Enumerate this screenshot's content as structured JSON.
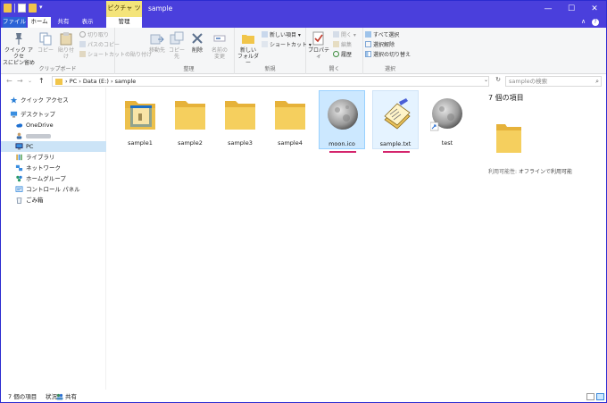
{
  "window": {
    "title": "sample",
    "context_tab": "ピクチャ ツール",
    "qat_dropdown": "▾",
    "controls": {
      "minimize": "—",
      "maximize": "☐",
      "close": "✕"
    }
  },
  "tabs": {
    "file": "ファイル",
    "home": "ホーム",
    "share": "共有",
    "view": "表示",
    "manage": "管理",
    "help": "?",
    "collapse": "∧"
  },
  "ribbon": {
    "clipboard": {
      "label": "クリップボード",
      "pin_line1": "クイック アクセ",
      "pin_line2": "スにピン留め",
      "copy": "コピー",
      "paste": "貼り付け",
      "cut": "切り取り",
      "copy_path": "パスのコピー",
      "paste_shortcut": "ショートカットの貼り付け"
    },
    "organize": {
      "label": "整理",
      "move_to": "移動先",
      "copy_to": "コピー先",
      "delete": "削除",
      "rename_line1": "名前の",
      "rename_line2": "変更"
    },
    "new": {
      "label": "新規",
      "new_folder_line1": "新しい",
      "new_folder_line2": "フォルダー",
      "new_item": "新しい項目 ▾",
      "shortcut": "ショートカット ▾"
    },
    "open": {
      "label": "開く",
      "properties": "プロパティ",
      "open": "開く ▾",
      "edit": "編集",
      "history": "履歴"
    },
    "select": {
      "label": "選択",
      "select_all": "すべて選択",
      "select_none": "選択解除",
      "invert": "選択の切り替え"
    }
  },
  "nav_bar": {
    "back": "←",
    "forward": "→",
    "recent": "⌄",
    "up": "↑",
    "breadcrumb": [
      "PC",
      "Data (E:)",
      "sample"
    ],
    "separator": "›",
    "dropdown": "⌄",
    "refresh": "↻",
    "search_placeholder": "sampleの検索",
    "search_icon": "⌕"
  },
  "nav_pane": {
    "items": [
      {
        "label": "クイック アクセス",
        "icon": "star-icon"
      },
      {
        "label": "デスクトップ",
        "icon": "desktop-icon"
      },
      {
        "label": "OneDrive",
        "icon": "cloud-icon"
      },
      {
        "label": "PC",
        "icon": "pc-icon"
      },
      {
        "label": "ライブラリ",
        "icon": "library-icon"
      },
      {
        "label": "ネットワーク",
        "icon": "network-icon"
      },
      {
        "label": "ホームグループ",
        "icon": "homegroup-icon"
      },
      {
        "label": "コントロール パネル",
        "icon": "control-panel-icon"
      },
      {
        "label": "ごみ箱",
        "icon": "recycle-bin-icon"
      }
    ]
  },
  "files": [
    {
      "name": "sample1"
    },
    {
      "name": "sample2"
    },
    {
      "name": "sample3"
    },
    {
      "name": "sample4"
    },
    {
      "name": "moon.ico"
    },
    {
      "name": "sample.txt"
    },
    {
      "name": "test"
    }
  ],
  "details": {
    "title": "7 個の項目",
    "availability_label": "利用可能性:",
    "availability_value": "オフラインで利用可能"
  },
  "status": {
    "count": "7 個の項目",
    "state_label": "状況:",
    "state_value": "共有"
  },
  "colors": {
    "titlebar": "#4a3fdc",
    "context_tab": "#f4e47a",
    "folder": "#f1c54a",
    "selection": "#cce8ff",
    "highlight_underline": "#d4246c"
  }
}
